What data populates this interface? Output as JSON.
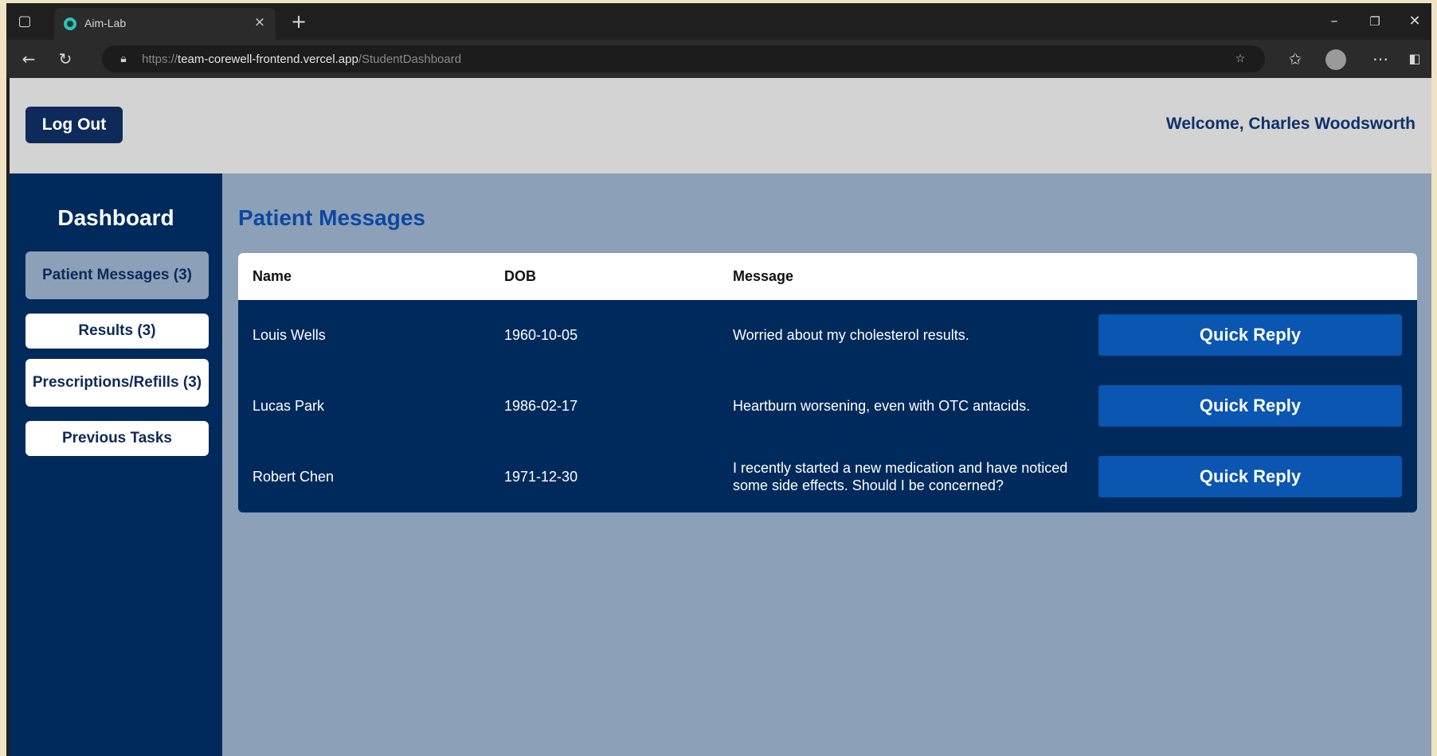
{
  "browser": {
    "tab_title": "Aim-Lab",
    "tab_close": "×",
    "new_tab": "+",
    "url_scheme": "https://",
    "url_host": "team-corewell-frontend.vercel.app",
    "url_path": "/StudentDashboard",
    "icons": [
      "tab-actions-icon",
      "site-icon",
      "back-icon",
      "reload-icon",
      "lock-icon",
      "star-icon",
      "favorites-icon",
      "profile-avatar",
      "more-icon",
      "sidebar-icon",
      "minimize-icon",
      "maximize-icon",
      "close-icon"
    ]
  },
  "header": {
    "logout_label": "Log Out",
    "welcome_text": "Welcome, Charles Woodsworth"
  },
  "sidebar": {
    "title": "Dashboard",
    "items": [
      {
        "label": "Patient Messages (3)",
        "active": true
      },
      {
        "label": "Results (3)",
        "active": false
      },
      {
        "label": "Prescriptions/Refills (3)",
        "active": false
      },
      {
        "label": "Previous Tasks",
        "active": false
      }
    ]
  },
  "main": {
    "title": "Patient Messages",
    "columns": [
      "Name",
      "DOB",
      "Message"
    ],
    "rows": [
      {
        "name": "Louis Wells",
        "dob": "1960-10-05",
        "message": "Worried about my cholesterol results.",
        "action": "Quick Reply"
      },
      {
        "name": "Lucas Park",
        "dob": "1986-02-17",
        "message": "Heartburn worsening, even with OTC antacids.",
        "action": "Quick Reply"
      },
      {
        "name": "Robert Chen",
        "dob": "1971-12-30",
        "message": "I recently started a new medication and have noticed some side effects. Should I be concerned?",
        "action": "Quick Reply"
      }
    ]
  },
  "colors": {
    "navy": "#002a5c",
    "accent_blue": "#0a56b0",
    "page_bg": "#8ca1b8",
    "header_bg": "#d3d3d3",
    "title_blue": "#0d47a1"
  }
}
